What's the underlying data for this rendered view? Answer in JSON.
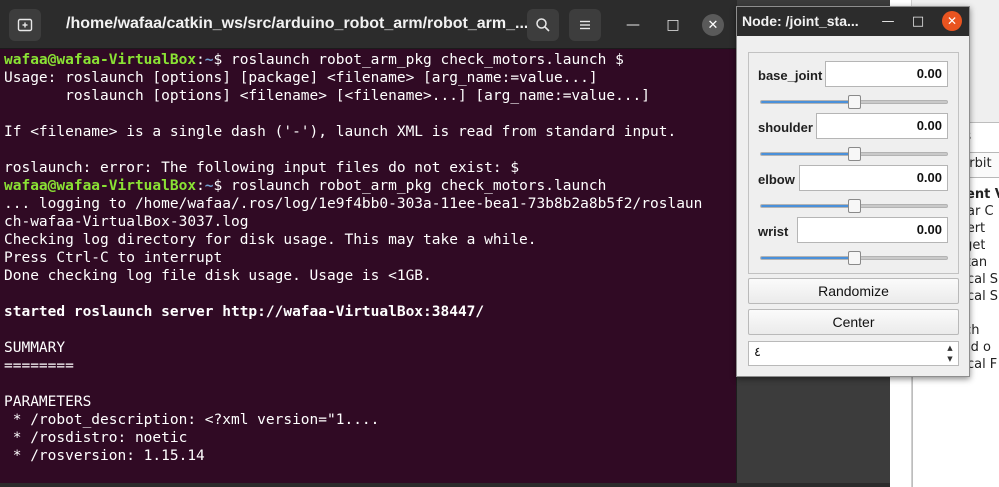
{
  "terminal": {
    "title": "/home/wafaa/catkin_ws/src/arduino_robot_arm/robot_arm_...",
    "new_tab_icon": "new-tab-icon",
    "search_icon": "search-icon",
    "menu_icon": "hamburger-menu-icon",
    "minimize_glyph": "—",
    "maximize_glyph": "□",
    "close_glyph": "✕",
    "prompt": {
      "user": "wafaa@wafaa-VirtualBox",
      "colon": ":",
      "path": "~",
      "symbol": "$ "
    },
    "lines": [
      {
        "type": "prompt",
        "command": "roslaunch robot_arm_pkg check_motors.launch $"
      },
      {
        "type": "text",
        "text": "Usage: roslaunch [options] [package] <filename> [arg_name:=value...]"
      },
      {
        "type": "text",
        "text": "       roslaunch [options] <filename> [<filename>...] [arg_name:=value...]"
      },
      {
        "type": "text",
        "text": ""
      },
      {
        "type": "text",
        "text": "If <filename> is a single dash ('-'), launch XML is read from standard input."
      },
      {
        "type": "text",
        "text": ""
      },
      {
        "type": "text",
        "text": "roslaunch: error: The following input files do not exist: $"
      },
      {
        "type": "prompt",
        "command": "roslaunch robot_arm_pkg check_motors.launch"
      },
      {
        "type": "text",
        "text": "... logging to /home/wafaa/.ros/log/1e9f4bb0-303a-11ee-bea1-73b8b2a8b5f2/roslaun"
      },
      {
        "type": "text",
        "text": "ch-wafaa-VirtualBox-3037.log"
      },
      {
        "type": "text",
        "text": "Checking log directory for disk usage. This may take a while."
      },
      {
        "type": "text",
        "text": "Press Ctrl-C to interrupt"
      },
      {
        "type": "text",
        "text": "Done checking log file disk usage. Usage is <1GB."
      },
      {
        "type": "text",
        "text": ""
      },
      {
        "type": "bold",
        "text": "started roslaunch server http://wafaa-VirtualBox:38447/"
      },
      {
        "type": "text",
        "text": ""
      },
      {
        "type": "text",
        "text": "SUMMARY"
      },
      {
        "type": "text",
        "text": "========"
      },
      {
        "type": "text",
        "text": ""
      },
      {
        "type": "text",
        "text": "PARAMETERS"
      },
      {
        "type": "text",
        "text": " * /robot_description: <?xml version=\"1...."
      },
      {
        "type": "text",
        "text": " * /rosdistro: noetic"
      },
      {
        "type": "text",
        "text": " * /rosversion: 1.15.14"
      }
    ]
  },
  "joint_gui": {
    "title": "Node: /joint_sta...",
    "minimize_glyph": "—",
    "maximize_glyph": "□",
    "close_glyph": "✕",
    "joints": [
      {
        "name": "base_joint",
        "value": "0.00",
        "slider_fraction": 0.5
      },
      {
        "name": "shoulder",
        "value": "0.00",
        "slider_fraction": 0.5
      },
      {
        "name": "elbow",
        "value": "0.00",
        "slider_fraction": 0.5
      },
      {
        "name": "wrist",
        "value": "0.00",
        "slider_fraction": 0.5
      }
    ],
    "randomize_label": "Randomize",
    "center_label": "Center",
    "spinbox_value": "٤",
    "spin_up_glyph": "▲",
    "spin_down_glyph": "▼"
  },
  "background_window": {
    "fragments": [
      "rs",
      "Orbit",
      "ent V",
      "ear C",
      "vert",
      "rget",
      "stan",
      "ocal S",
      "ocal S",
      "w",
      "tch",
      "eld o",
      "ocal F"
    ]
  },
  "colors": {
    "terminal_bg": "#300a24",
    "prompt_user": "#8ae234",
    "prompt_path": "#729fcf",
    "titlebar": "#2c2c2c",
    "close_accent": "#e95420"
  }
}
